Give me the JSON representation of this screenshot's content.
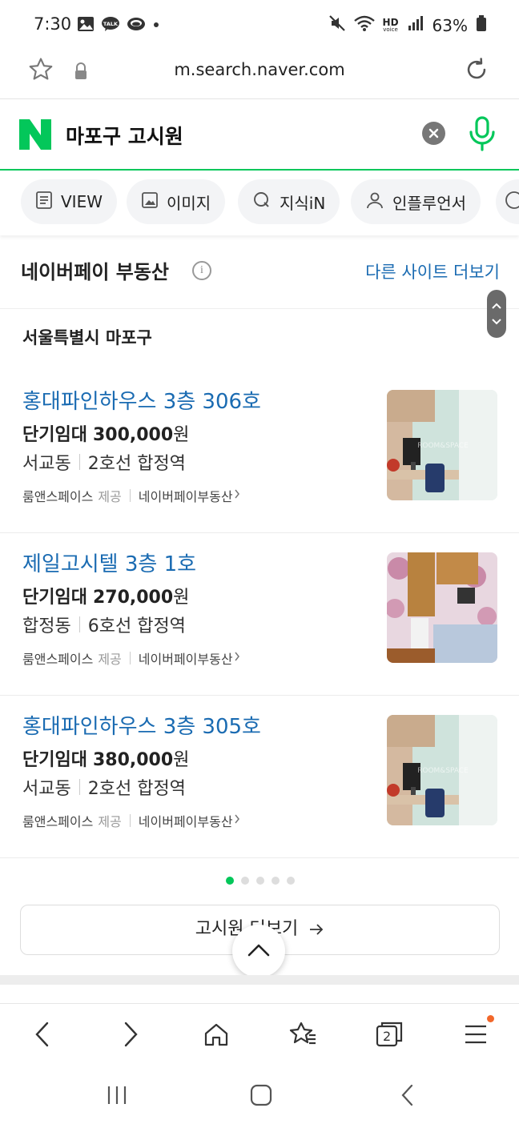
{
  "status_bar": {
    "time": "7:30",
    "left_icons": [
      "gallery-icon",
      "kakaotalk-icon",
      "chat-bubble-icon",
      "dot-icon"
    ],
    "right_icons": [
      "mute-icon",
      "wifi-icon",
      "hd-voice-icon",
      "signal-icon"
    ],
    "hd_label": "HD",
    "voice_label": "voice",
    "battery": "63%"
  },
  "browser": {
    "url": "m.search.naver.com"
  },
  "search": {
    "query": "마포구 고시원",
    "logo_letter": "N",
    "brand_color": "#03c75a"
  },
  "tabs": [
    {
      "label": "VIEW",
      "icon": "document-icon"
    },
    {
      "label": "이미지",
      "icon": "image-icon"
    },
    {
      "label": "지식iN",
      "icon": "q-icon"
    },
    {
      "label": "인플루언서",
      "icon": "person-icon"
    }
  ],
  "section": {
    "title": "네이버페이 부동산",
    "more_link": "다른 사이트 더보기",
    "region": "서울특별시 마포구"
  },
  "listings": [
    {
      "title": "홍대파인하우스 3층 306호",
      "price_type": "단기임대",
      "price": "300,000",
      "price_unit": "원",
      "dong": "서교동",
      "station": "2호선 합정역",
      "provider": "룸앤스페이스",
      "provider_suffix": "제공",
      "source": "네이버페이부동산"
    },
    {
      "title": "제일고시텔 3층 1호",
      "price_type": "단기임대",
      "price": "270,000",
      "price_unit": "원",
      "dong": "합정동",
      "station": "6호선 합정역",
      "provider": "룸앤스페이스",
      "provider_suffix": "제공",
      "source": "네이버페이부동산"
    },
    {
      "title": "홍대파인하우스 3층 305호",
      "price_type": "단기임대",
      "price": "380,000",
      "price_unit": "원",
      "dong": "서교동",
      "station": "2호선 합정역",
      "provider": "룸앤스페이스",
      "provider_suffix": "제공",
      "source": "네이버페이부동산"
    }
  ],
  "pagination": {
    "total": 5,
    "active": 1
  },
  "more_button": "고시원 더보기",
  "toolbar": {
    "tabs_count": "2"
  },
  "colors": {
    "link": "#1a6bb2",
    "accent": "#03c75a",
    "notify": "#f2672a"
  }
}
